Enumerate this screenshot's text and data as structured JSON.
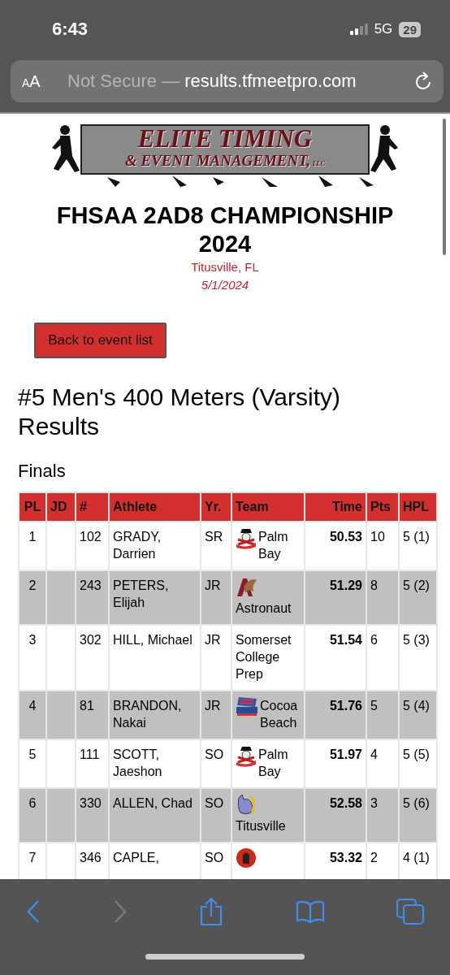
{
  "status_bar": {
    "time": "6:43",
    "network": "5G",
    "battery": "29"
  },
  "address_bar": {
    "text_size_button": "AA",
    "security": "Not Secure —",
    "url": "results.tfmeetpro.com"
  },
  "logo": {
    "line_1": "ELITE TIMING",
    "line_2": "& EVENT MANAGEMENT,",
    "suffix": "LLC"
  },
  "meet": {
    "title": "FHSAA 2AD8 CHAMPIONSHIP 2024",
    "location": "Titusville, FL",
    "date": "5/1/2024"
  },
  "back_button": "Back to event list",
  "event_title": "#5 Men's 400 Meters (Varsity) Results",
  "section": "Finals",
  "table": {
    "columns": [
      "PL",
      "JD",
      "#",
      "Athlete",
      "Yr.",
      "Team",
      "Time",
      "Pts",
      "HPL"
    ],
    "rows": [
      {
        "pl": "1",
        "number": "102",
        "athlete": "GRADY, Darrien",
        "year": "SR",
        "team_logo": {
          "kind": "pirate"
        },
        "team": "Palm Bay",
        "time": "50.53",
        "pts": "10",
        "hpl": "5 (1)"
      },
      {
        "pl": "2",
        "number": "243",
        "athlete": "PETERS, Elijah",
        "year": "JR",
        "team_logo": {
          "kind": "eagle"
        },
        "team": "Astronaut",
        "time": "51.29",
        "pts": "8",
        "hpl": "5 (2)"
      },
      {
        "pl": "3",
        "number": "302",
        "athlete": "HILL, Michael",
        "year": "JR",
        "team": "Somerset College Prep",
        "time": "51.54",
        "pts": "6",
        "hpl": "5 (3)"
      },
      {
        "pl": "4",
        "number": "81",
        "athlete": "BRANDON, Nakai",
        "year": "JR",
        "team_logo": {
          "kind": "flag"
        },
        "team": "Cocoa Beach",
        "time": "51.76",
        "pts": "5",
        "hpl": "5 (4)"
      },
      {
        "pl": "5",
        "number": "111",
        "athlete": "SCOTT, Jaeshon",
        "year": "SO",
        "team_logo": {
          "kind": "pirate"
        },
        "team": "Palm Bay",
        "time": "51.97",
        "pts": "4",
        "hpl": "5 (5)"
      },
      {
        "pl": "6",
        "number": "330",
        "athlete": "ALLEN, Chad",
        "year": "SO",
        "team_logo": {
          "kind": "rhino"
        },
        "team": "Titusville",
        "time": "52.58",
        "pts": "3",
        "hpl": "5 (6)"
      },
      {
        "pl": "7",
        "number": "346",
        "athlete": "CAPLE,",
        "year": "SO",
        "team_logo": {
          "kind": "warrior"
        },
        "time": "53.32",
        "pts": "2",
        "hpl": "4 (1)"
      }
    ]
  },
  "toolbar": [
    {
      "kind": "back",
      "disabled": false
    },
    {
      "kind": "forward",
      "disabled": true
    },
    {
      "kind": "share",
      "disabled": false
    },
    {
      "kind": "bookmarks",
      "disabled": false
    },
    {
      "kind": "tabs",
      "disabled": false
    }
  ]
}
